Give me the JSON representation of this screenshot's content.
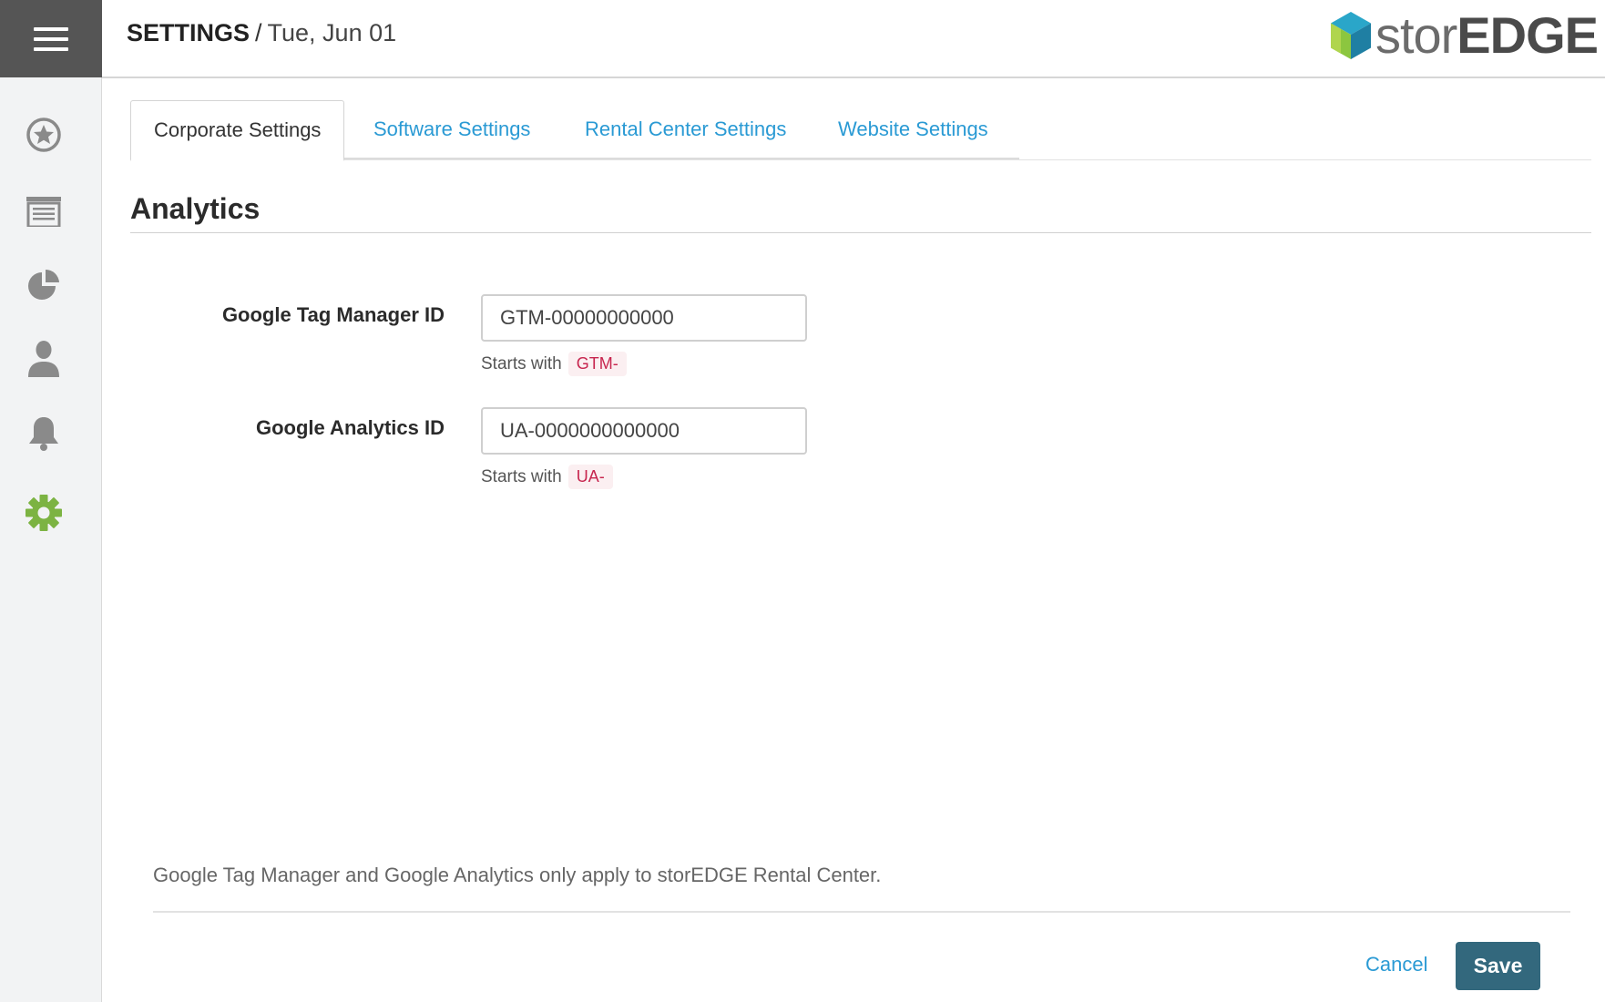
{
  "header": {
    "title": "SETTINGS",
    "separator": "/",
    "date": "Tue, Jun 01",
    "logo": {
      "light": "stor",
      "bold": "EDGE"
    }
  },
  "sidebar": {
    "menu_icon": "hamburger-menu-icon",
    "items": [
      {
        "icon": "star-badge-icon"
      },
      {
        "icon": "storage-unit-icon"
      },
      {
        "icon": "pie-chart-icon"
      },
      {
        "icon": "user-icon"
      },
      {
        "icon": "bell-icon"
      },
      {
        "icon": "gear-icon",
        "active": true
      }
    ]
  },
  "tabs": [
    {
      "label": "Corporate Settings",
      "active": true
    },
    {
      "label": "Software Settings"
    },
    {
      "label": "Rental Center Settings"
    },
    {
      "label": "Website Settings"
    }
  ],
  "section": {
    "title": "Analytics"
  },
  "fields": {
    "gtm": {
      "label": "Google Tag Manager ID",
      "value": "GTM-00000000000",
      "hint_text": "Starts with",
      "hint_code": "GTM-"
    },
    "ga": {
      "label": "Google Analytics ID",
      "value": "UA-0000000000000",
      "hint_text": "Starts with",
      "hint_code": "UA-"
    }
  },
  "footer": {
    "note": "Google Tag Manager and Google Analytics only apply to storEDGE Rental Center.",
    "cancel_label": "Cancel",
    "save_label": "Save"
  },
  "colors": {
    "link": "#2a9ad4",
    "save_button": "#33687d",
    "active_nav": "#7cb342",
    "code_text": "#c7254e",
    "sidebar_bg": "#f2f3f4",
    "menu_bg": "#555555"
  }
}
